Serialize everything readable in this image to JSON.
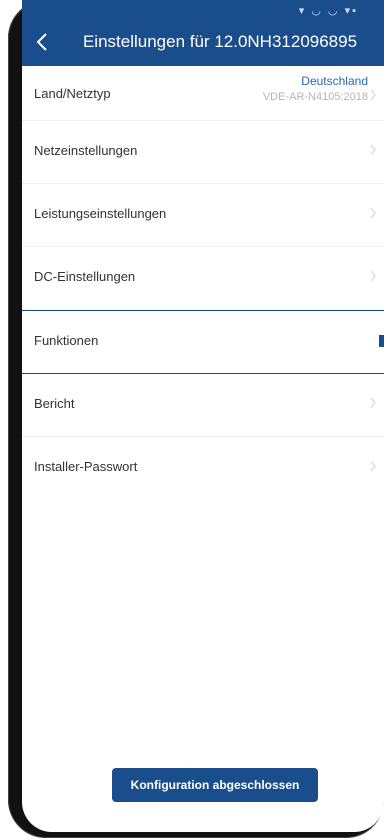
{
  "header": {
    "title": "Einstellungen für 12.0NH312096895",
    "status_icons": "▾ ◡ ◡ ▾▪",
    "back_icon": "chevron-left-icon",
    "color": "#1a4d8c"
  },
  "list": {
    "country": {
      "label": "Land/Netztyp",
      "value": "Deutschland",
      "subvalue": "VDE-AR-N4105:2018"
    },
    "items": [
      {
        "label": "Netzeinstellungen"
      },
      {
        "label": "Leistungseinstellungen"
      },
      {
        "label": "DC-Einstellungen"
      },
      {
        "label": "Funktionen"
      },
      {
        "label": "Bericht"
      },
      {
        "label": "Installer-Passwort"
      }
    ],
    "selected_index": 3
  },
  "footer": {
    "button_label": "Konfiguration abgeschlossen"
  }
}
